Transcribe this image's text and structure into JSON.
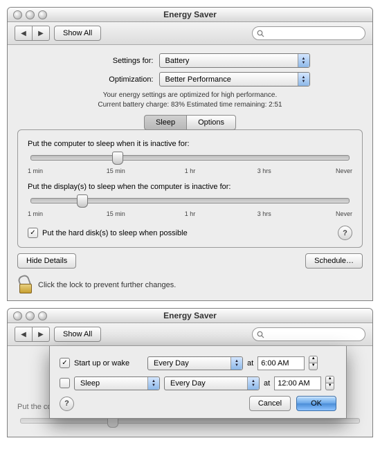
{
  "window1": {
    "title": "Energy Saver",
    "toolbar": {
      "show_all": "Show All"
    },
    "settings": {
      "settings_for_label": "Settings for:",
      "settings_for_value": "Battery",
      "optimization_label": "Optimization:",
      "optimization_value": "Better Performance"
    },
    "status": {
      "line1": "Your energy settings are optimized for high performance.",
      "line2": "Current battery charge: 83%  Estimated time remaining: 2:51"
    },
    "tabs": {
      "sleep": "Sleep",
      "options": "Options",
      "active": "sleep"
    },
    "sliders": {
      "computer": {
        "label": "Put the computer to sleep when it is inactive for:",
        "ticks": [
          "1 min",
          "15 min",
          "1 hr",
          "3 hrs",
          "Never"
        ],
        "thumb_percent": 27
      },
      "display": {
        "label": "Put the display(s) to sleep when the computer is inactive for:",
        "ticks": [
          "1 min",
          "15 min",
          "1 hr",
          "3 hrs",
          "Never"
        ],
        "thumb_percent": 16
      }
    },
    "disk_checkbox": {
      "checked": true,
      "label": "Put the hard disk(s) to sleep when possible"
    },
    "buttons": {
      "hide_details": "Hide Details",
      "schedule": "Schedule…"
    },
    "lock_text": "Click the lock to prevent further changes."
  },
  "window2": {
    "title": "Energy Saver",
    "toolbar": {
      "show_all": "Show All"
    },
    "sheet": {
      "row1": {
        "checked": true,
        "label": "Start up or wake",
        "day": "Every Day",
        "at": "at",
        "time": "6:00 AM"
      },
      "row2": {
        "checked": false,
        "action": "Sleep",
        "day": "Every Day",
        "at": "at",
        "time": "12:00 AM"
      },
      "cancel": "Cancel",
      "ok": "OK"
    },
    "background_label": "Put the computer to sleep when it is inactive for:"
  }
}
